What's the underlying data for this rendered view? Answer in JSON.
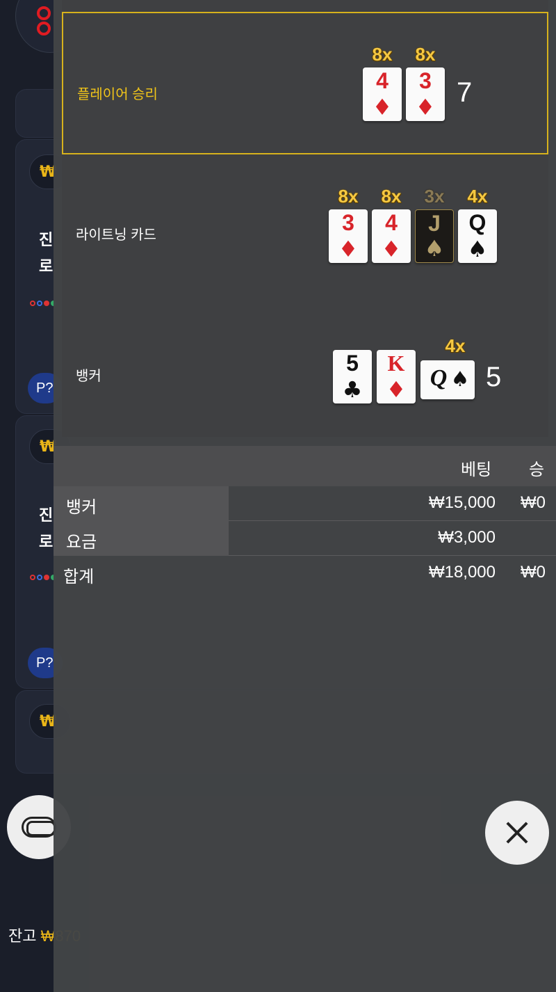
{
  "background": {
    "cards": [
      {
        "pill": "₩",
        "title_text": "진",
        "line2": "로"
      },
      {
        "pill": "₩",
        "title_text": "진",
        "line2": "로"
      },
      {
        "pill": "₩"
      }
    ],
    "pp_badge": "P?",
    "balance_label": "잔고",
    "balance_value": "₩870"
  },
  "results": {
    "player": {
      "label": "플레이어 승리",
      "score": "7",
      "cards": [
        {
          "rank": "4",
          "suit": "♦",
          "color": "red",
          "multiplier": "8x"
        },
        {
          "rank": "3",
          "suit": "♦",
          "color": "red",
          "multiplier": "8x"
        }
      ]
    },
    "lightning": {
      "label": "라이트닝 카드",
      "cards": [
        {
          "rank": "3",
          "suit": "♦",
          "color": "red",
          "multiplier": "8x"
        },
        {
          "rank": "4",
          "suit": "♦",
          "color": "red",
          "multiplier": "8x"
        },
        {
          "rank": "J",
          "suit": "♠",
          "color": "gold",
          "multiplier": "3x"
        },
        {
          "rank": "Q",
          "suit": "♠",
          "color": "black",
          "multiplier": "4x"
        }
      ]
    },
    "banker": {
      "label": "뱅커",
      "score": "5",
      "cards": [
        {
          "rank": "5",
          "suit": "♣",
          "color": "black"
        },
        {
          "rank": "K",
          "suit": "♦",
          "color": "red"
        },
        {
          "rank": "Q",
          "suit": "♠",
          "color": "black",
          "multiplier": "4x",
          "sideways": true
        }
      ]
    }
  },
  "bets": {
    "header": {
      "bet": "베팅",
      "win": "승"
    },
    "rows": [
      {
        "label": "뱅커",
        "bet": "₩15,000",
        "win": "₩0"
      },
      {
        "label": "요금",
        "bet": "₩3,000",
        "win": ""
      }
    ],
    "total": {
      "label": "합계",
      "bet": "₩18,000",
      "win": "₩0"
    }
  },
  "colors": {
    "gold": "#f0c419",
    "red": "#d8242a",
    "panel": "#424446"
  }
}
